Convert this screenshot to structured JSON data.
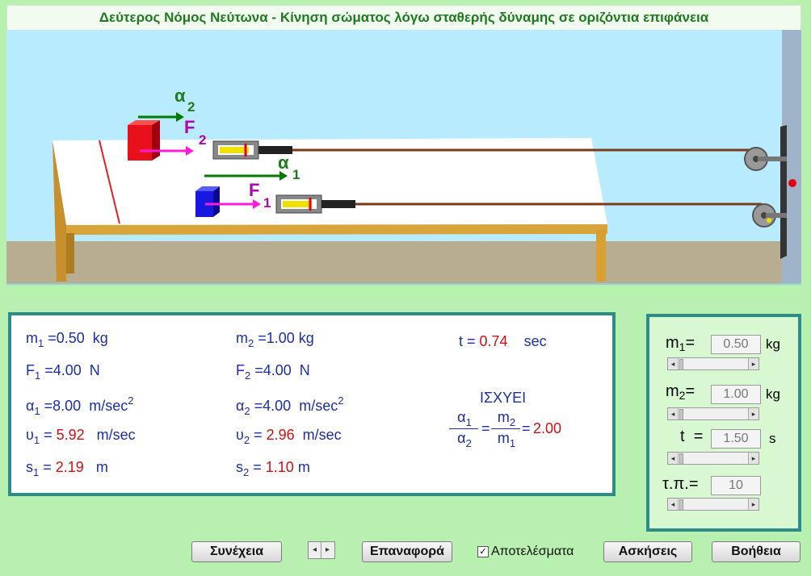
{
  "title": "Δεύτερος Νόμος Νεύτωνα - Κίνηση σώματος λόγω σταθερής δύναμης σε οριζόντια επιφάνεια",
  "scene": {
    "a2": "α",
    "a2_sub": "2",
    "f2": "F",
    "f2_sub": "2",
    "a1": "α",
    "a1_sub": "1",
    "f1": "F",
    "f1_sub": "1"
  },
  "results": {
    "m1_label": "m",
    "m1_sub": "1",
    "m1_eq": " =0.50",
    "m1_unit": "kg",
    "f1_label": "F",
    "f1_sub": "1",
    "f1_eq": " =4.00",
    "f1_unit": "N",
    "a1_label": "α",
    "a1_sub": "1",
    "a1_eq": " =8.00",
    "a1_unit": "m/sec",
    "a1_unit_sup": "2",
    "u1_label": "υ",
    "u1_sub": "1",
    "u1_eq": " = ",
    "u1_value": "5.92",
    "u1_unit": "m/sec",
    "s1_label": "s",
    "s1_sub": "1",
    "s1_eq": " = ",
    "s1_value": "2.19",
    "s1_unit": "m",
    "m2_label": "m",
    "m2_sub": "2",
    "m2_eq": " =1.00",
    "m2_unit": "kg",
    "f2_label": "F",
    "f2_sub": "2",
    "f2_eq": " =4.00",
    "f2_unit": "N",
    "a2_label": "α",
    "a2_sub": "2",
    "a2_eq": " =4.00",
    "a2_unit": "m/sec",
    "a2_unit_sup": "2",
    "u2_label": "υ",
    "u2_sub": "2",
    "u2_eq": " = ",
    "u2_value": "2.96",
    "u2_unit": "m/sec",
    "s2_label": "s",
    "s2_sub": "2",
    "s2_eq": " = ",
    "s2_value": "1.10",
    "s2_unit": "m",
    "t_label": "t = ",
    "t_value": "0.74",
    "t_unit": "sec",
    "holds": "ΙΣΧΥΕΙ",
    "frac1_num": "α",
    "frac1_num_sub": "1",
    "frac1_den": "α",
    "frac1_den_sub": "2",
    "frac2_num": "m",
    "frac2_num_sub": "2",
    "frac2_den": "m",
    "frac2_den_sub": "1",
    "eq1": "=",
    "eq2": "=",
    "ratio_value": "2.00"
  },
  "controls": {
    "m1_label": "m",
    "m1_sub": "1",
    "m1_eq": "=",
    "m1_value": "0.50",
    "m1_unit": "kg",
    "m2_label": "m",
    "m2_sub": "2",
    "m2_eq": "=",
    "m2_value": "1.00",
    "m2_unit": "kg",
    "t_label": "t",
    "t_eq": "=",
    "t_value": "1.50",
    "t_unit": "s",
    "tp_label": "τ.π.",
    "tp_eq": "=",
    "tp_value": "10"
  },
  "buttons": {
    "continue": "Συνέχεια",
    "reset": "Επαναφορά",
    "results_checkbox": "Αποτελέσματα",
    "exercises": "Ασκήσεις",
    "help": "Βοήθεια"
  },
  "colors": {
    "accent_green": "#1f7a1f",
    "panel_border": "#2f8a8a",
    "value_red": "#d01010",
    "text_blue": "#1a2ea8",
    "force_magenta": "#b400b4"
  }
}
